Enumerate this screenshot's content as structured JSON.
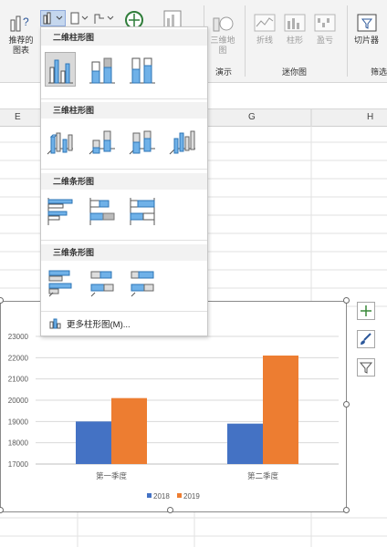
{
  "ribbon": {
    "recommended_charts": "推荐的\n图表",
    "3d_map": "三维地\n图",
    "line": "折线",
    "column": "柱形",
    "win_loss": "盈亏",
    "slicer": "切片器",
    "tours_label": "演示",
    "sparklines_label": "迷你图",
    "filter_label": "筛选"
  },
  "dropdown": {
    "sec1": "二维柱形图",
    "sec2": "三维柱形图",
    "sec3": "二维条形图",
    "sec4": "三维条形图",
    "more": "更多柱形图(M)..."
  },
  "columns": [
    "E",
    "G",
    "H"
  ],
  "chart_data": {
    "type": "bar",
    "categories": [
      "第一季度",
      "第二季度"
    ],
    "series": [
      {
        "name": "2018",
        "values": [
          19000,
          18900
        ],
        "color": "#4472c4"
      },
      {
        "name": "2019",
        "values": [
          20100,
          22100
        ],
        "color": "#ed7d31"
      }
    ],
    "ylim": [
      17000,
      23000
    ],
    "yticks": [
      "17000",
      "18000",
      "19000",
      "20000",
      "21000",
      "22000",
      "23000"
    ],
    "legend": "bottom",
    "grid": true
  }
}
